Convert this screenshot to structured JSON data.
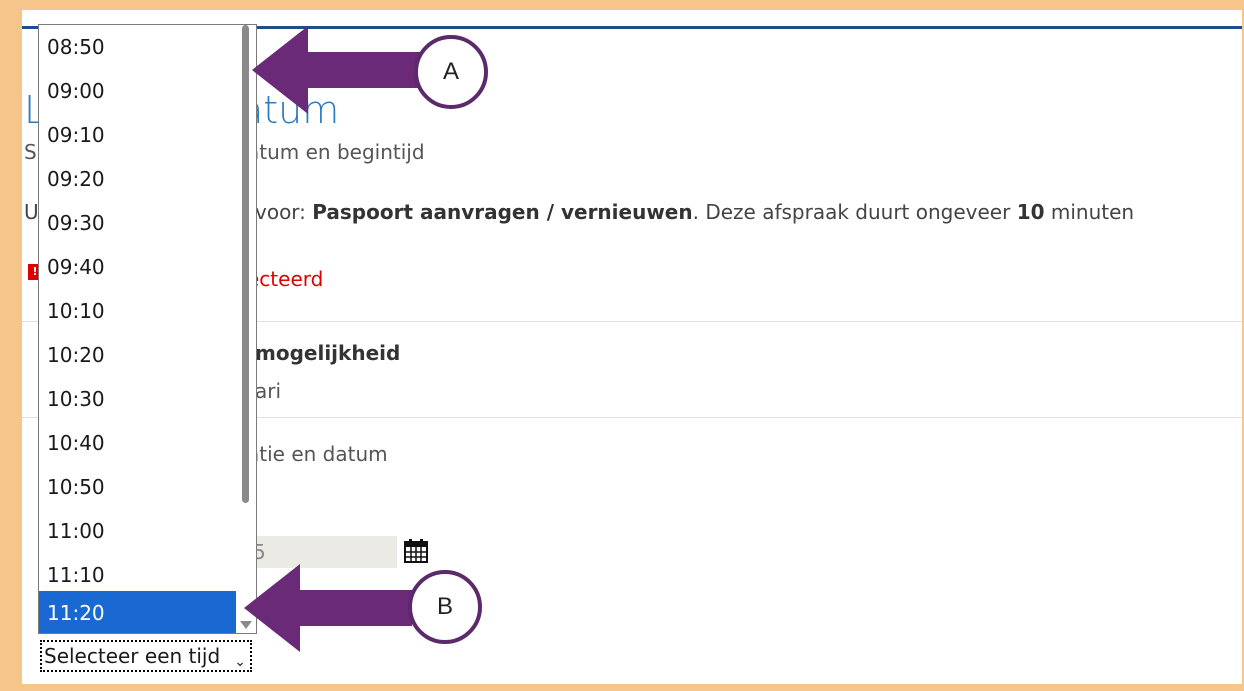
{
  "page": {
    "title_start": "L",
    "title_end": "atum",
    "subtitle_start": "S",
    "subtitle_end": "atum en begintijd",
    "intro_start": "U",
    "intro_prefix": "voor: ",
    "intro_product": "Paspoort aanvragen / vernieuwen",
    "intro_middle": ". Deze afspraak duurt ongeveer ",
    "intro_duration": "10",
    "intro_suffix": " minuten",
    "error_text": "ecteerd",
    "section_heading": "mogelijkheid",
    "section_sub": "ari",
    "location_label": "atie en datum",
    "date_value_fragment": "5"
  },
  "time_dropdown": {
    "options": [
      "08:50",
      "09:00",
      "09:10",
      "09:20",
      "09:30",
      "09:40",
      "10:10",
      "10:20",
      "10:30",
      "10:40",
      "10:50",
      "11:00",
      "11:10",
      "11:20"
    ],
    "selected": "11:20",
    "collapsed_label": "Selecteer een tijd"
  },
  "annotations": {
    "a_label": "A",
    "b_label": "B"
  },
  "colors": {
    "frame": "#f5c58b",
    "accent_blue": "#2b7bc0",
    "selected_option": "#1a69d2",
    "error_red": "#e00000",
    "callout_purple": "#5a2a6b"
  }
}
